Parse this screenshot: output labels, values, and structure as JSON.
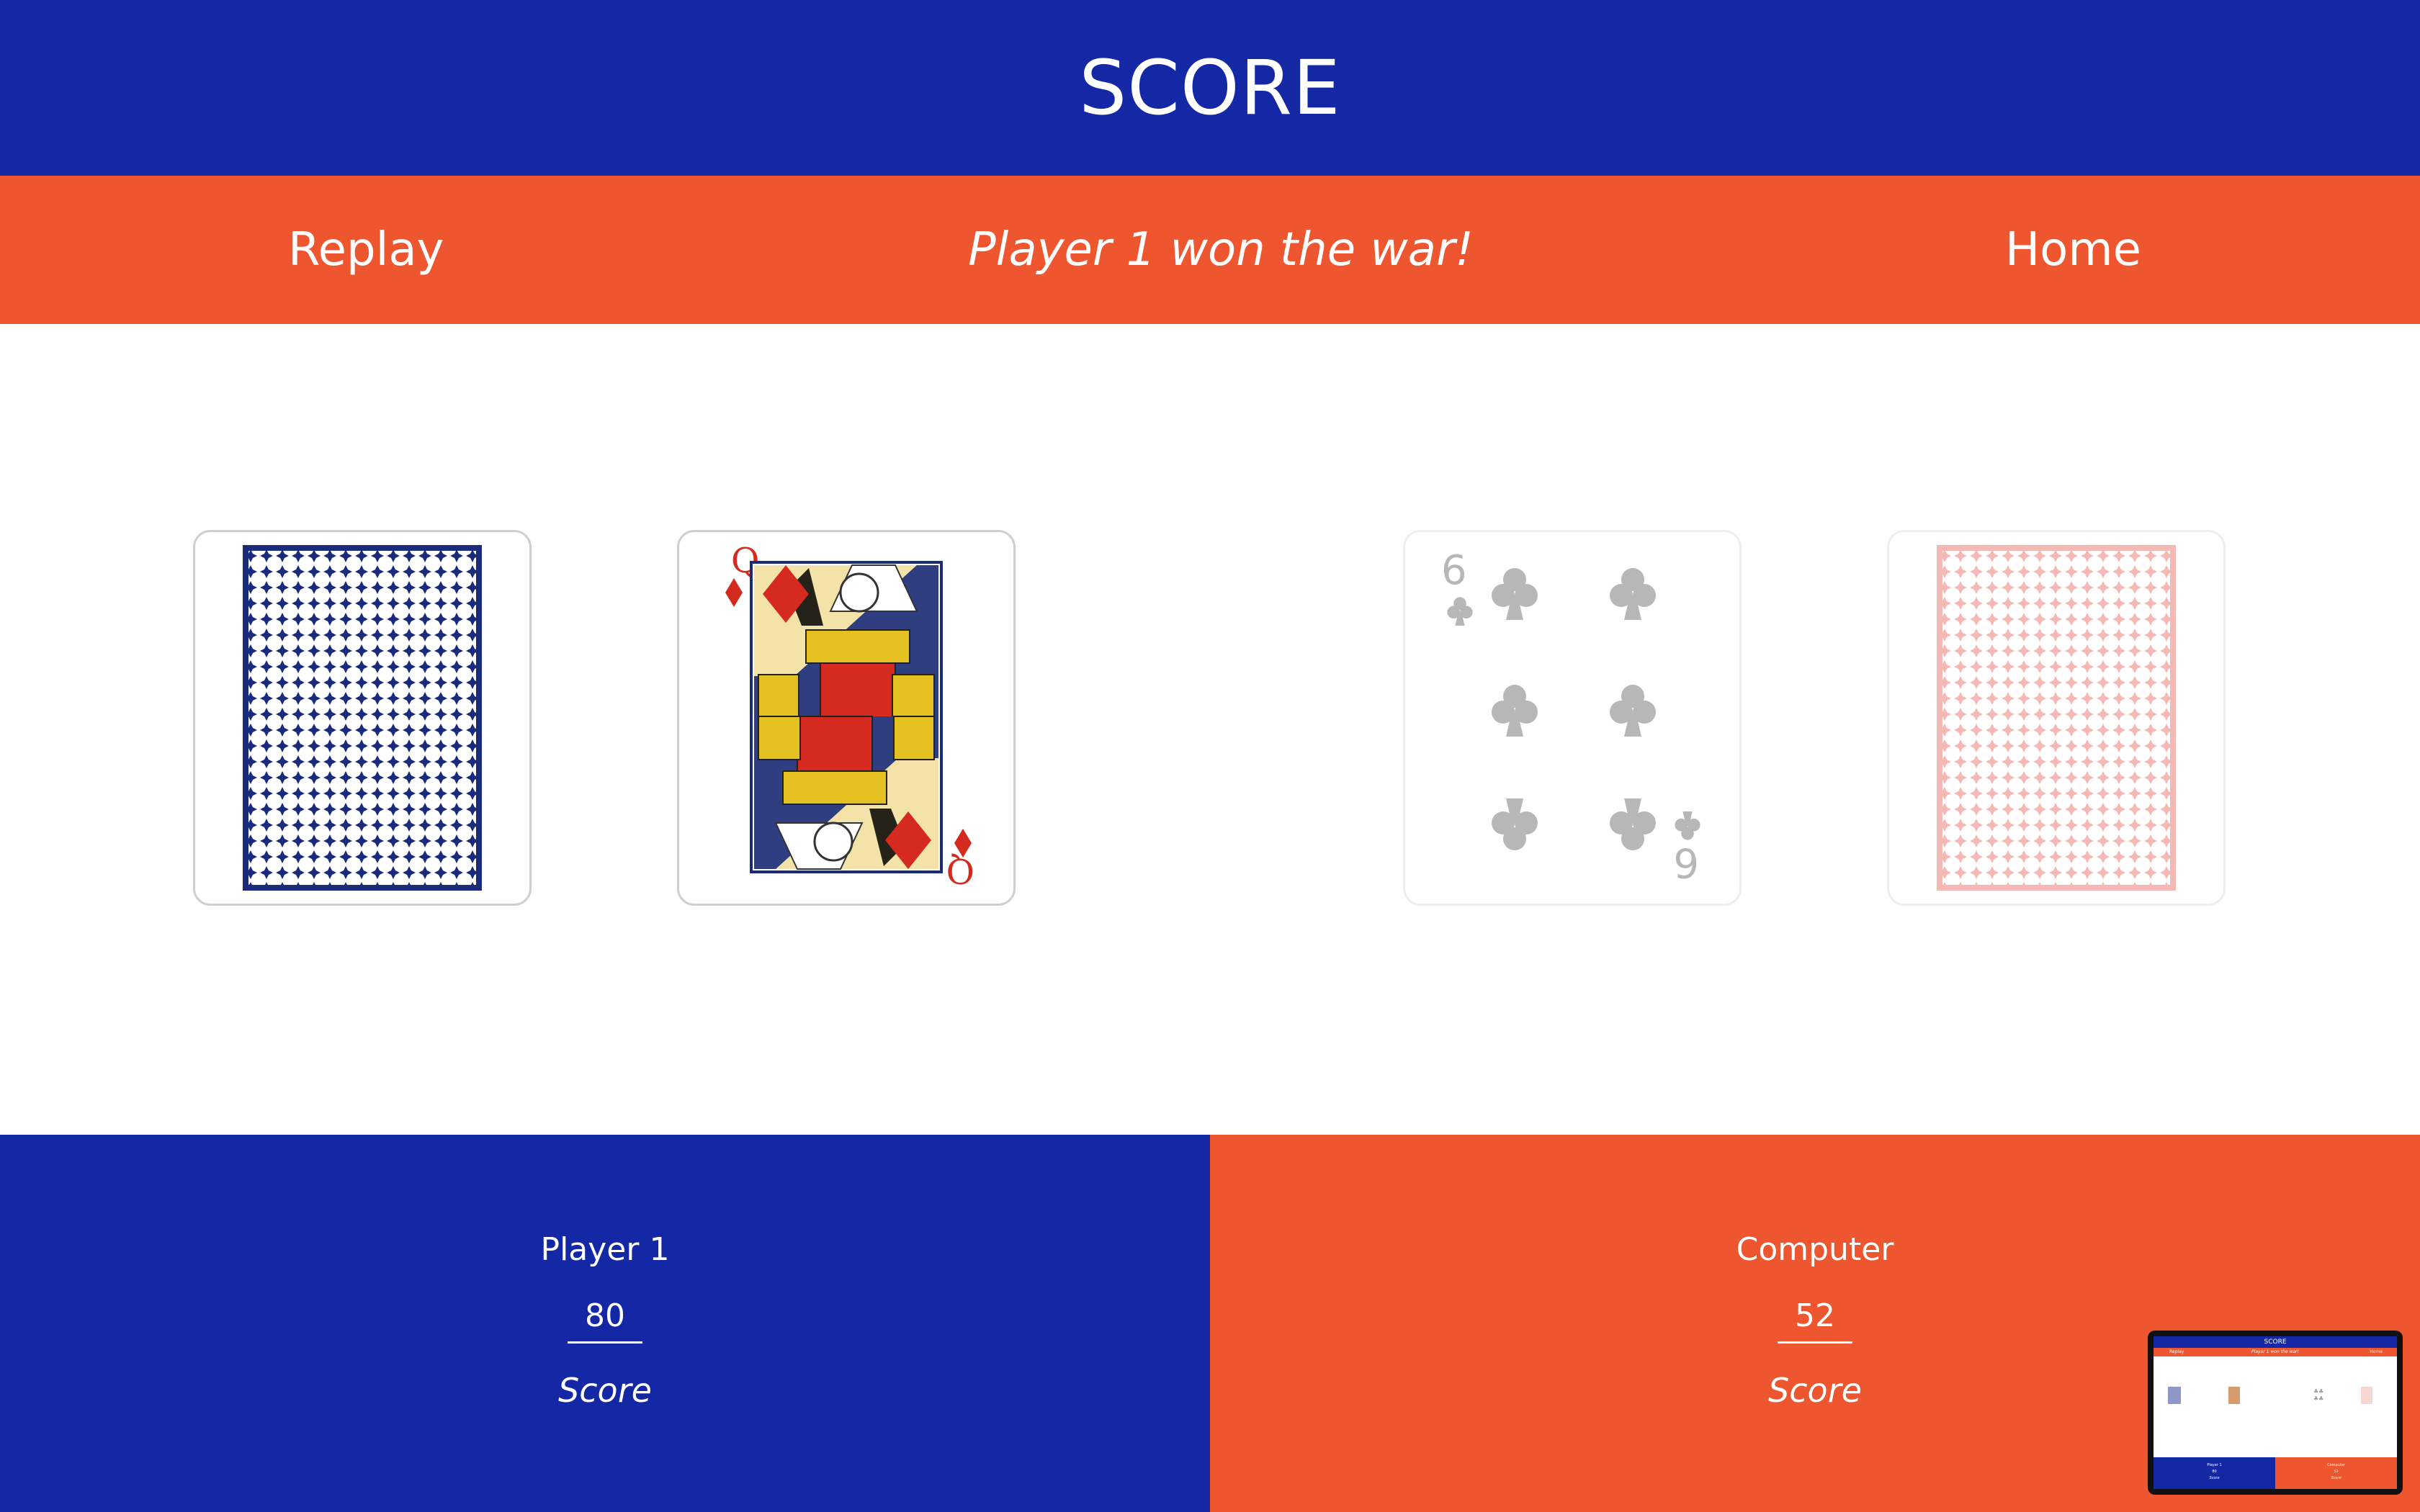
{
  "header": {
    "title": "SCORE"
  },
  "nav": {
    "replay_label": "Replay",
    "status_message": "Player 1 won the war!",
    "home_label": "Home"
  },
  "cards": [
    {
      "type": "card-back",
      "color": "#1a2b7c"
    },
    {
      "type": "face",
      "rank": "Q",
      "suit": "diamonds",
      "color": "#d42a1f"
    },
    {
      "type": "face",
      "rank": "6",
      "suit": "clubs",
      "dimmed": true,
      "color": "#555555"
    },
    {
      "type": "card-back",
      "color": "#e23a2e",
      "dimmed": true
    }
  ],
  "players": {
    "player": {
      "name": "Player 1",
      "score": "80",
      "score_label": "Score"
    },
    "computer": {
      "name": "Computer",
      "score": "52",
      "score_label": "Score"
    }
  },
  "colors": {
    "primary_blue": "#1428a6",
    "accent_orange": "#ee5630"
  },
  "thumbnail": {
    "title": "SCORE",
    "replay": "Replay",
    "status": "Player 1 won the war!",
    "home": "Home",
    "player_name": "Player 1",
    "player_score": "80",
    "computer_name": "Computer",
    "computer_score": "52",
    "score_label": "Score"
  }
}
